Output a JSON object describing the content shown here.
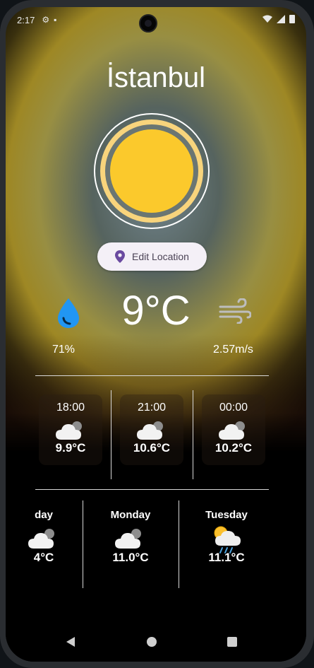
{
  "status_bar": {
    "time": "2:17"
  },
  "city": "İstanbul",
  "edit_location": {
    "label": "Edit Location"
  },
  "current": {
    "temperature": "9°C",
    "humidity": "71%",
    "wind": "2.57m/s"
  },
  "hourly": [
    {
      "time": "18:00",
      "temp": "9.9°C",
      "icon": "cloud-icon"
    },
    {
      "time": "21:00",
      "temp": "10.6°C",
      "icon": "cloud-icon"
    },
    {
      "time": "00:00",
      "temp": "10.2°C",
      "icon": "cloud-icon"
    }
  ],
  "daily": [
    {
      "day": "day",
      "temp": "4°C",
      "icon": "cloud-icon"
    },
    {
      "day": "Monday",
      "temp": "11.0°C",
      "icon": "cloud-icon"
    },
    {
      "day": "Tuesday",
      "temp": "11.1°C",
      "icon": "sun-rain-icon"
    }
  ],
  "colors": {
    "sun": "#fbc92c",
    "accent": "#6a4aa0",
    "drop": "#2196f3"
  }
}
